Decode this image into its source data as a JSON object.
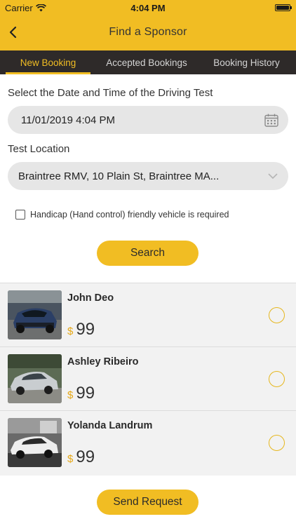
{
  "status_bar": {
    "carrier": "Carrier",
    "time": "4:04 PM"
  },
  "nav": {
    "title": "Find a Sponsor",
    "back_icon": "chevron-left-icon"
  },
  "tabs": [
    {
      "label": "New Booking",
      "active": true
    },
    {
      "label": "Accepted Bookings",
      "active": false
    },
    {
      "label": "Booking History",
      "active": false
    }
  ],
  "form": {
    "date_label": "Select the Date and Time of the Driving Test",
    "date_value": "11/01/2019 4:04 PM",
    "location_label": "Test Location",
    "location_value": "Braintree RMV, 10 Plain St, Braintree MA...",
    "handicap_label": "Handicap (Hand control) friendly vehicle is required",
    "handicap_checked": false,
    "search_label": "Search"
  },
  "sponsors": [
    {
      "name": "John Deo",
      "currency": "$",
      "price": "99",
      "selected": false
    },
    {
      "name": "Ashley Ribeiro",
      "currency": "$",
      "price": "99",
      "selected": false
    },
    {
      "name": "Yolanda Landrum",
      "currency": "$",
      "price": "99",
      "selected": false
    }
  ],
  "send_request_label": "Send Request",
  "colors": {
    "accent": "#f1bd23",
    "tab_bar": "#2e2a29",
    "field_bg": "#e6e6e6",
    "list_bg": "#f2f2f2"
  }
}
